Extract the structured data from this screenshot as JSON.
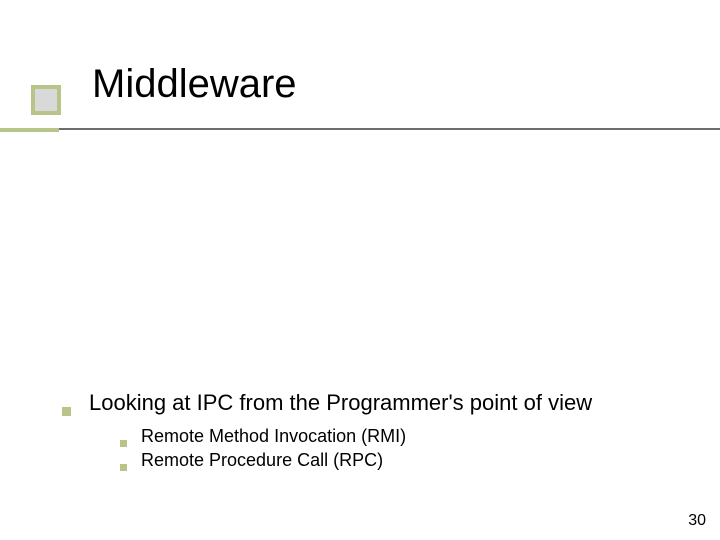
{
  "title": "Middleware",
  "main_bullet": "Looking at IPC from the Programmer's point of view",
  "sub_bullets": [
    "Remote Method Invocation (RMI)",
    "Remote Procedure Call (RPC)"
  ],
  "page_number": "30"
}
